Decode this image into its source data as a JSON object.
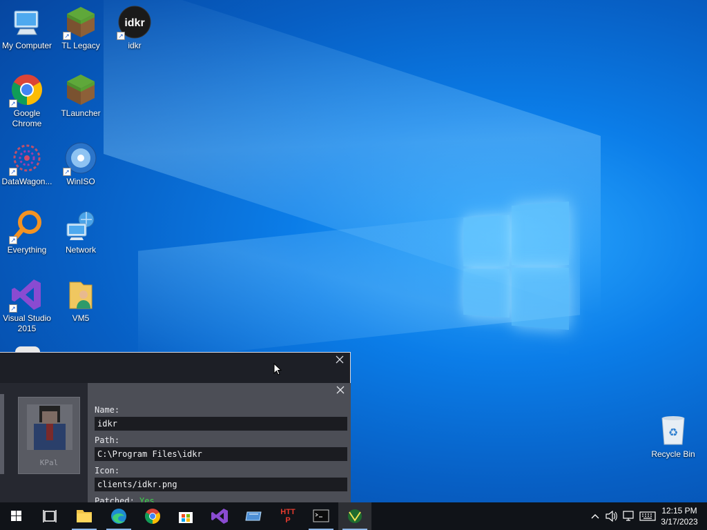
{
  "desktop": {
    "icons": [
      {
        "label": "My Computer"
      },
      {
        "label": "TL Legacy"
      },
      {
        "label": "idkr"
      },
      {
        "label": "Google Chrome"
      },
      {
        "label": "TLauncher"
      },
      {
        "label": "DataWagon..."
      },
      {
        "label": "WinISO"
      },
      {
        "label": "Everything"
      },
      {
        "label": "Network"
      },
      {
        "label": "Visual Studio 2015"
      },
      {
        "label": "VM5"
      },
      {
        "label": "Recycle Bin"
      }
    ],
    "idkr_logo_text": "idkr"
  },
  "window": {
    "client_card": {
      "name": "KPal"
    },
    "panel": {
      "name_label": "Name:",
      "name_value": "idkr",
      "path_label": "Path:",
      "path_value": "C:\\Program Files\\idkr",
      "icon_label": "Icon:",
      "icon_value": "clients/idkr.png",
      "patched_label": "Patched:",
      "patched_value": "Yes"
    }
  },
  "taskbar": {
    "apps": [
      {
        "icon": "start-icon"
      },
      {
        "icon": "task-view-icon"
      },
      {
        "icon": "file-explorer-icon"
      },
      {
        "icon": "edge-icon"
      },
      {
        "icon": "chrome-icon"
      },
      {
        "icon": "store-icon"
      },
      {
        "icon": "visual-studio-icon"
      },
      {
        "icon": "app-icon"
      },
      {
        "icon": "http-debugger-icon",
        "text": "HTTP"
      },
      {
        "icon": "terminal-icon"
      },
      {
        "icon": "launcher-icon"
      }
    ],
    "clock": {
      "time": "12:15 PM",
      "date": "3/17/2023"
    }
  },
  "colors": {
    "accent": "#0b7de8",
    "taskbar": "#101318",
    "patched_yes": "#3cd34a"
  }
}
